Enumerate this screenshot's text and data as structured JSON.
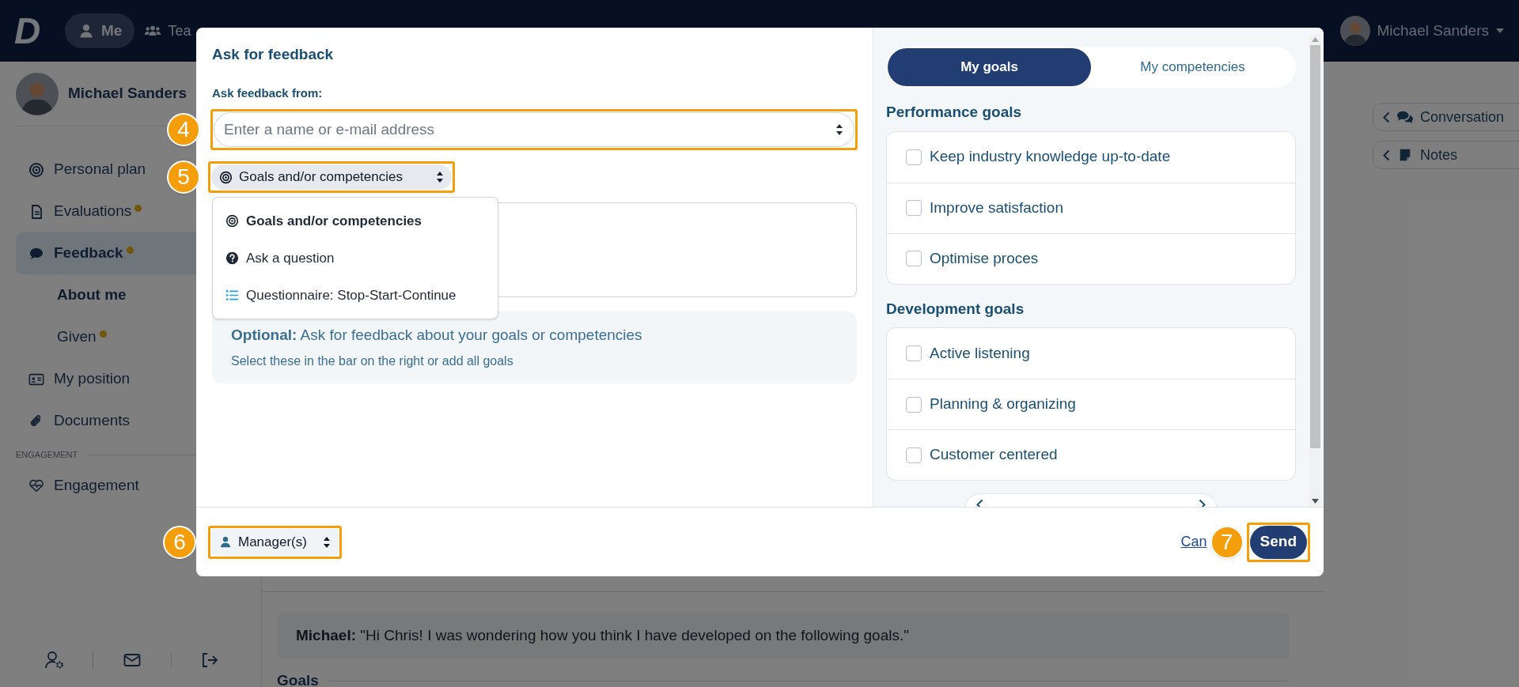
{
  "top_bar": {
    "logo": "D",
    "nav": [
      {
        "label": "Me",
        "kind": "user",
        "selected": true
      },
      {
        "label": "Tea",
        "kind": "team",
        "selected": false
      }
    ],
    "user_name": "Michael Sanders"
  },
  "sidebar": {
    "profile_name": "Michael Sanders",
    "groups": [
      {
        "items": [
          {
            "label": "Personal plan",
            "kind": "target",
            "selected": false,
            "unread": false
          },
          {
            "label": "Evaluations",
            "kind": "document",
            "selected": false,
            "unread": true
          },
          {
            "label": "Feedback",
            "kind": "chat",
            "selected": true,
            "unread": true,
            "children": [
              {
                "label": "About me",
                "selected": true,
                "unread": false
              },
              {
                "label": "Given",
                "selected": false,
                "unread": true
              }
            ]
          },
          {
            "label": "My position",
            "kind": "idcard",
            "selected": false,
            "unread": false
          },
          {
            "label": "Documents",
            "kind": "clip",
            "selected": false,
            "unread": false
          }
        ]
      },
      {
        "heading": "ENGAGEMENT",
        "items": [
          {
            "label": "Engagement",
            "kind": "heart",
            "selected": false,
            "unread": false
          }
        ]
      }
    ]
  },
  "main": {
    "message": "**Michael:** \"Hi Chris! I was wondering how you think I have developed on the following goals.\"",
    "section_heading": "Goals",
    "side_tabs": [
      {
        "label": "Conversation",
        "kind": "chats"
      },
      {
        "label": "Notes",
        "kind": "note"
      }
    ]
  },
  "modal": {
    "title": "Ask for feedback",
    "from_label": "Ask feedback from:",
    "recipient_field": {
      "placeholder": "Enter a name or e-mail address",
      "step": "4"
    },
    "type_select": {
      "value": "Goals and/or competencies",
      "kind": "target",
      "step": "5"
    },
    "type_options": [
      {
        "label": "Goals and/or competencies",
        "kind": "target",
        "selected": true
      },
      {
        "label": "Ask a question",
        "kind": "question",
        "selected": false
      },
      {
        "label": "Questionnaire: Stop-Start-Continue",
        "kind": "list",
        "selected": false
      }
    ],
    "info": {
      "title": "**Optional:** Ask for feedback about your goals or competencies",
      "text": "Select these in the bar on the right or add all goals"
    },
    "audience_select": {
      "value": "Manager(s)",
      "kind": "user",
      "step": "6"
    },
    "cancel_link": "Can",
    "send_button": {
      "label": "Send",
      "step": "7"
    },
    "panel": {
      "tabs": [
        {
          "label": "My goals",
          "selected": true
        },
        {
          "label": "My competencies",
          "selected": false
        }
      ],
      "groups": [
        {
          "heading": "Performance goals",
          "items": [
            {
              "label": "Keep industry knowledge up-to-date",
              "checked": false
            },
            {
              "label": "Improve satisfaction",
              "checked": false
            },
            {
              "label": "Optimise proces",
              "checked": false
            }
          ]
        },
        {
          "heading": "Development goals",
          "items": [
            {
              "label": "Active listening",
              "checked": false
            },
            {
              "label": "Planning & organizing",
              "checked": false
            },
            {
              "label": "Customer centered",
              "checked": false
            }
          ]
        }
      ]
    }
  }
}
